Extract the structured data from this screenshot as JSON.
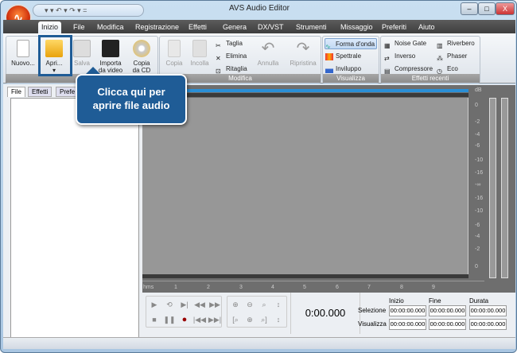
{
  "window": {
    "title": "AVS Audio Editor",
    "min": "–",
    "max": "□",
    "close": "X",
    "qat": "▾  ▾  ↶ ▾  ↷ ▾   ="
  },
  "tabs": [
    "Inizio",
    "File",
    "Modifica",
    "Registrazione",
    "Effetti",
    "Genera",
    "DX/VST",
    "Strumenti",
    "Missaggio",
    "Preferiti",
    "Aiuto"
  ],
  "ribbon": {
    "file_group": {
      "new": "Nuovo...",
      "open": "Apri...",
      "save": "Salva",
      "import1": "Importa",
      "import2": "da video",
      "copy1": "Copia",
      "copy2": "da CD",
      "arrow": "▾"
    },
    "modifica": {
      "label": "Modifica",
      "copy": "Copia",
      "paste": "Incolla",
      "cut": "Taglia",
      "delete": "Elimina",
      "trim": "Ritaglia",
      "undo": "Annulla",
      "redo": "Ripristina"
    },
    "visualizza": {
      "label": "Visualizza",
      "waveform": "Forma d'onda",
      "spectral": "Spettrale",
      "envelope": "Inviluppo"
    },
    "recenti": {
      "label": "Effetti recenti",
      "noise": "Noise Gate",
      "invert": "Inverso",
      "compressor": "Compressore",
      "reverb": "Riverbero",
      "phaser": "Phaser",
      "echo": "Eco"
    }
  },
  "callout": {
    "line1": "Clicca qui per",
    "line2": "aprire file audio"
  },
  "panel_tabs": [
    "File",
    "Effetti",
    "Prefe"
  ],
  "db_scale": {
    "unit": "dB",
    "labels": [
      "0",
      "-2",
      "-4",
      "-6",
      "-10",
      "-16",
      "-∞",
      "-16",
      "-10",
      "-6",
      "-4",
      "-2",
      "0"
    ]
  },
  "ruler": {
    "unit": "hms",
    "ticks": [
      "1",
      "2",
      "3",
      "4",
      "5",
      "6",
      "7",
      "8",
      "9"
    ]
  },
  "time_display": "0:00.000",
  "selection": {
    "col_start": "Inizio",
    "col_end": "Fine",
    "col_duration": "Durata",
    "row_sel": "Selezione",
    "row_view": "Visualizza",
    "sel_values": [
      "00:00:00.000",
      "00:00:00.000",
      "00:00:00.000"
    ],
    "view_values": [
      "00:00:00.000",
      "00:00:00.000",
      "00:00:00.000"
    ]
  },
  "transport": {
    "play": "▶",
    "loop": "⟲",
    "play_sel": "▶|",
    "rew": "◀◀",
    "ff": "▶▶",
    "stop": "■",
    "pause": "❚❚",
    "record": "●",
    "start": "|◀◀",
    "end": "▶▶|"
  },
  "zoom": {
    "zin": "⊕",
    "zout": "⊖",
    "zsel": "⌕",
    "zv": "↕",
    "zfull": "[⌕",
    "zin2": "⊕",
    "zfit": "⌕]",
    "zv2": "↕"
  }
}
